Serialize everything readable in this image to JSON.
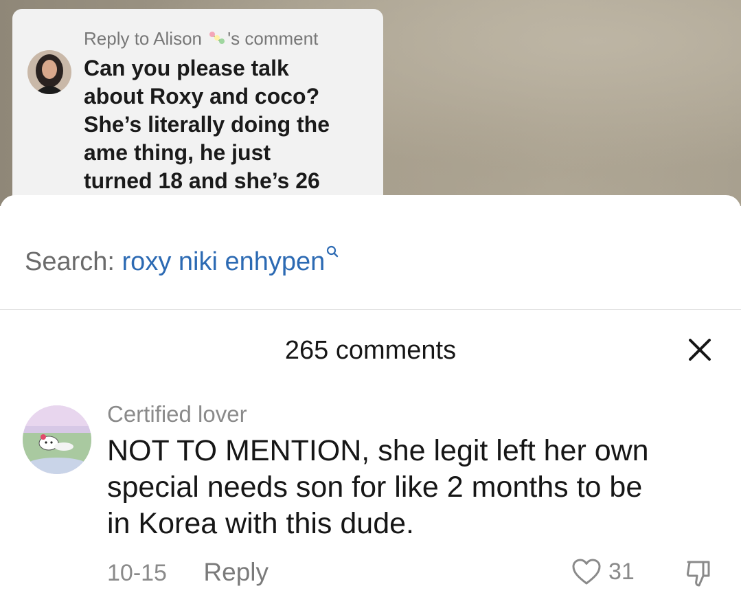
{
  "reply_card": {
    "header_prefix": "Reply to Alison",
    "header_suffix": "'s comment",
    "lines": [
      "Can you please talk",
      "about Roxy and coco?",
      "She’s literally doing the",
      "ame thing, he just",
      "turned 18 and she’s 26"
    ]
  },
  "search": {
    "prefix": "Search:",
    "term": "roxy niki enhypen",
    "icon": "search-icon"
  },
  "comments_panel": {
    "title": "265 comments",
    "close_icon": "close-icon"
  },
  "comment": {
    "username": "Certified lover",
    "lines": [
      "NOT TO MENTION, she legit left her own",
      "special needs son for like 2 months to be",
      "in Korea with this dude."
    ],
    "date": "10-15",
    "reply_label": "Reply",
    "like_count": "31",
    "like_icon": "heart-icon",
    "dislike_icon": "thumbs-down-icon"
  },
  "colors": {
    "search_term": "#2c6ab3",
    "muted_text": "#8a8a8a",
    "primary_text": "#161616"
  }
}
